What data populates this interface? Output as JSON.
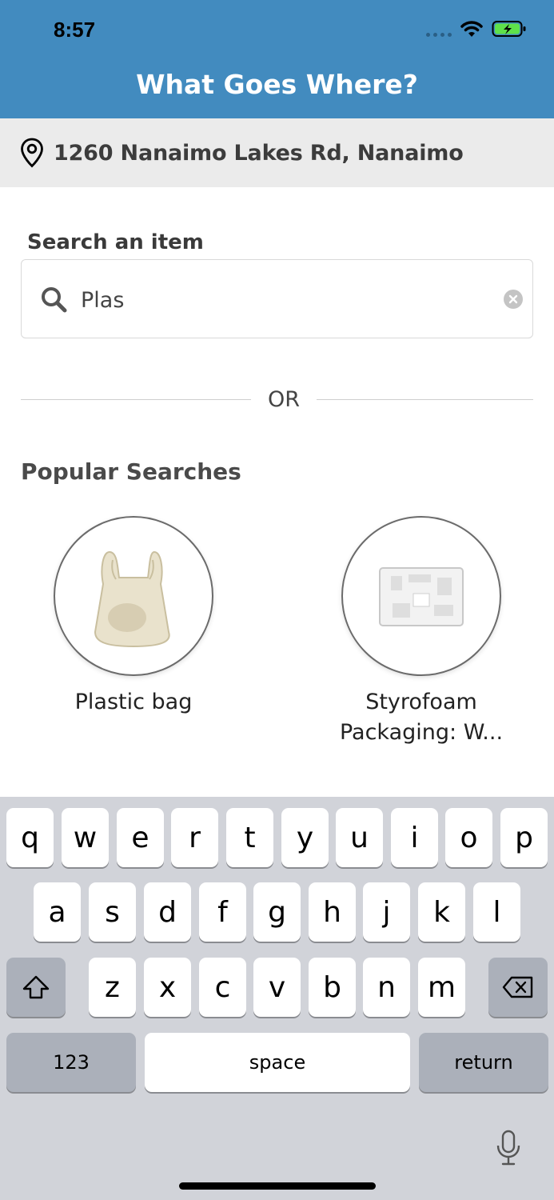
{
  "status_bar": {
    "time": "8:57"
  },
  "app": {
    "title": "What Goes Where?"
  },
  "location": {
    "address": "1260 Nanaimo Lakes Rd, Nanaimo"
  },
  "search": {
    "label": "Search an item",
    "value": "Plas"
  },
  "divider": {
    "text": "OR"
  },
  "popular": {
    "title": "Popular Searches",
    "items": [
      {
        "label": "Plastic bag"
      },
      {
        "label": "Styrofoam Packaging: W..."
      }
    ]
  },
  "keyboard": {
    "row1": [
      "q",
      "w",
      "e",
      "r",
      "t",
      "y",
      "u",
      "i",
      "o",
      "p"
    ],
    "row2": [
      "a",
      "s",
      "d",
      "f",
      "g",
      "h",
      "j",
      "k",
      "l"
    ],
    "row3": [
      "z",
      "x",
      "c",
      "v",
      "b",
      "n",
      "m"
    ],
    "numbers_label": "123",
    "space_label": "space",
    "return_label": "return"
  },
  "colors": {
    "header": "#428bbf",
    "location_bg": "#ebebeb",
    "keyboard_bg": "#d1d3d9"
  }
}
